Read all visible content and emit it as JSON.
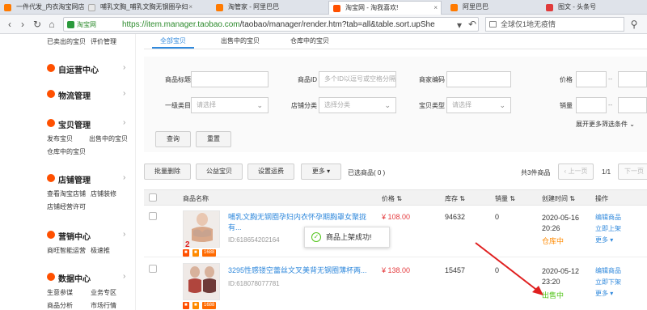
{
  "browser": {
    "tabs": [
      {
        "label": "一件代发_内衣淘宝网店加盟"
      },
      {
        "label": "哺乳文胸_哺乳文胸无钢圈孕妇"
      },
      {
        "label": "淘管家 - 阿里巴巴"
      },
      {
        "label": "淘宝网 - 淘我喜欢!"
      },
      {
        "label": "阿里巴巴"
      },
      {
        "label": "图文 - 头条号"
      }
    ],
    "site_label": "淘宝网",
    "url_host": "https://item.manager.taobao.com",
    "url_path": "/taobao/manager/render.htm?tab=all&table.sort.upShe",
    "search_text": "全球仅1地无疫情"
  },
  "sidebar": {
    "top_links": [
      "已卖出的宝贝",
      "评价管理"
    ],
    "sections": [
      {
        "title": "自运营中心",
        "items": []
      },
      {
        "title": "物流管理",
        "items": []
      },
      {
        "title": "宝贝管理",
        "items": [
          "发布宝贝",
          "出售中的宝贝",
          "仓库中的宝贝"
        ]
      },
      {
        "title": "店铺管理",
        "items": [
          "查看淘宝店铺",
          "店铺装修",
          "店铺经营许可"
        ]
      },
      {
        "title": "营销中心",
        "items": [
          "商旺智能运营",
          "极速推"
        ]
      },
      {
        "title": "数据中心",
        "items": [
          "生意参谋",
          "业务专区",
          "商品分析",
          "市场行情"
        ]
      }
    ]
  },
  "page_tabs": [
    "全部宝贝",
    "出售中的宝贝",
    "仓库中的宝贝"
  ],
  "filters": {
    "title_label": "商品标题",
    "id_label": "商品ID",
    "id_placeholder": "多个ID以逗号或空格分隔",
    "code_label": "商家编码",
    "price_label": "价格",
    "cat_label": "一级类目",
    "cat_placeholder": "请选择",
    "shopcat_label": "店铺分类",
    "shopcat_placeholder": "选择分类",
    "type_label": "宝贝类型",
    "type_placeholder": "请选择",
    "sales_label": "销量",
    "expand": "展开更多筛选条件",
    "range_sep": "--"
  },
  "actions": {
    "query": "查询",
    "reset": "重置",
    "bulk_delete": "批量删除",
    "public_item": "公益宝贝",
    "shipping": "设置运费",
    "more": "更多",
    "selected": "已选商品( 0 )",
    "total": "共3件商品",
    "prev": "上一页",
    "page": "1/1",
    "next": "下一页"
  },
  "table": {
    "headers": [
      "商品名称",
      "价格",
      "库存",
      "销量",
      "创建时间",
      "操作"
    ],
    "rows": [
      {
        "title": "哺乳文胸无钢圈孕妇内衣怀孕期胸罩女聚拢有...",
        "id": "ID:618654202164",
        "price": "¥ 108.00",
        "stock": "94632",
        "sales": "0",
        "created": "2020-05-16 20:26",
        "status": "仓库中",
        "ops": [
          "编辑商品",
          "立即上架",
          "更多"
        ]
      },
      {
        "title": "3295性感镂空蕾丝文叉美背无钢圈薄杯两...",
        "id": "ID:618078077781",
        "price": "¥ 138.00",
        "stock": "15457",
        "sales": "0",
        "created": "2020-05-12 23:20",
        "status": "出售中",
        "ops": [
          "编辑商品",
          "立即下架",
          "更多"
        ]
      }
    ],
    "badge": "1688"
  },
  "toast": {
    "text": "商品上架成功!"
  },
  "colors": {
    "accent": "#3089dc",
    "brand": "#ff5000",
    "price": "#e4393c",
    "green": "#52c41a",
    "arrow": "#e02020"
  }
}
